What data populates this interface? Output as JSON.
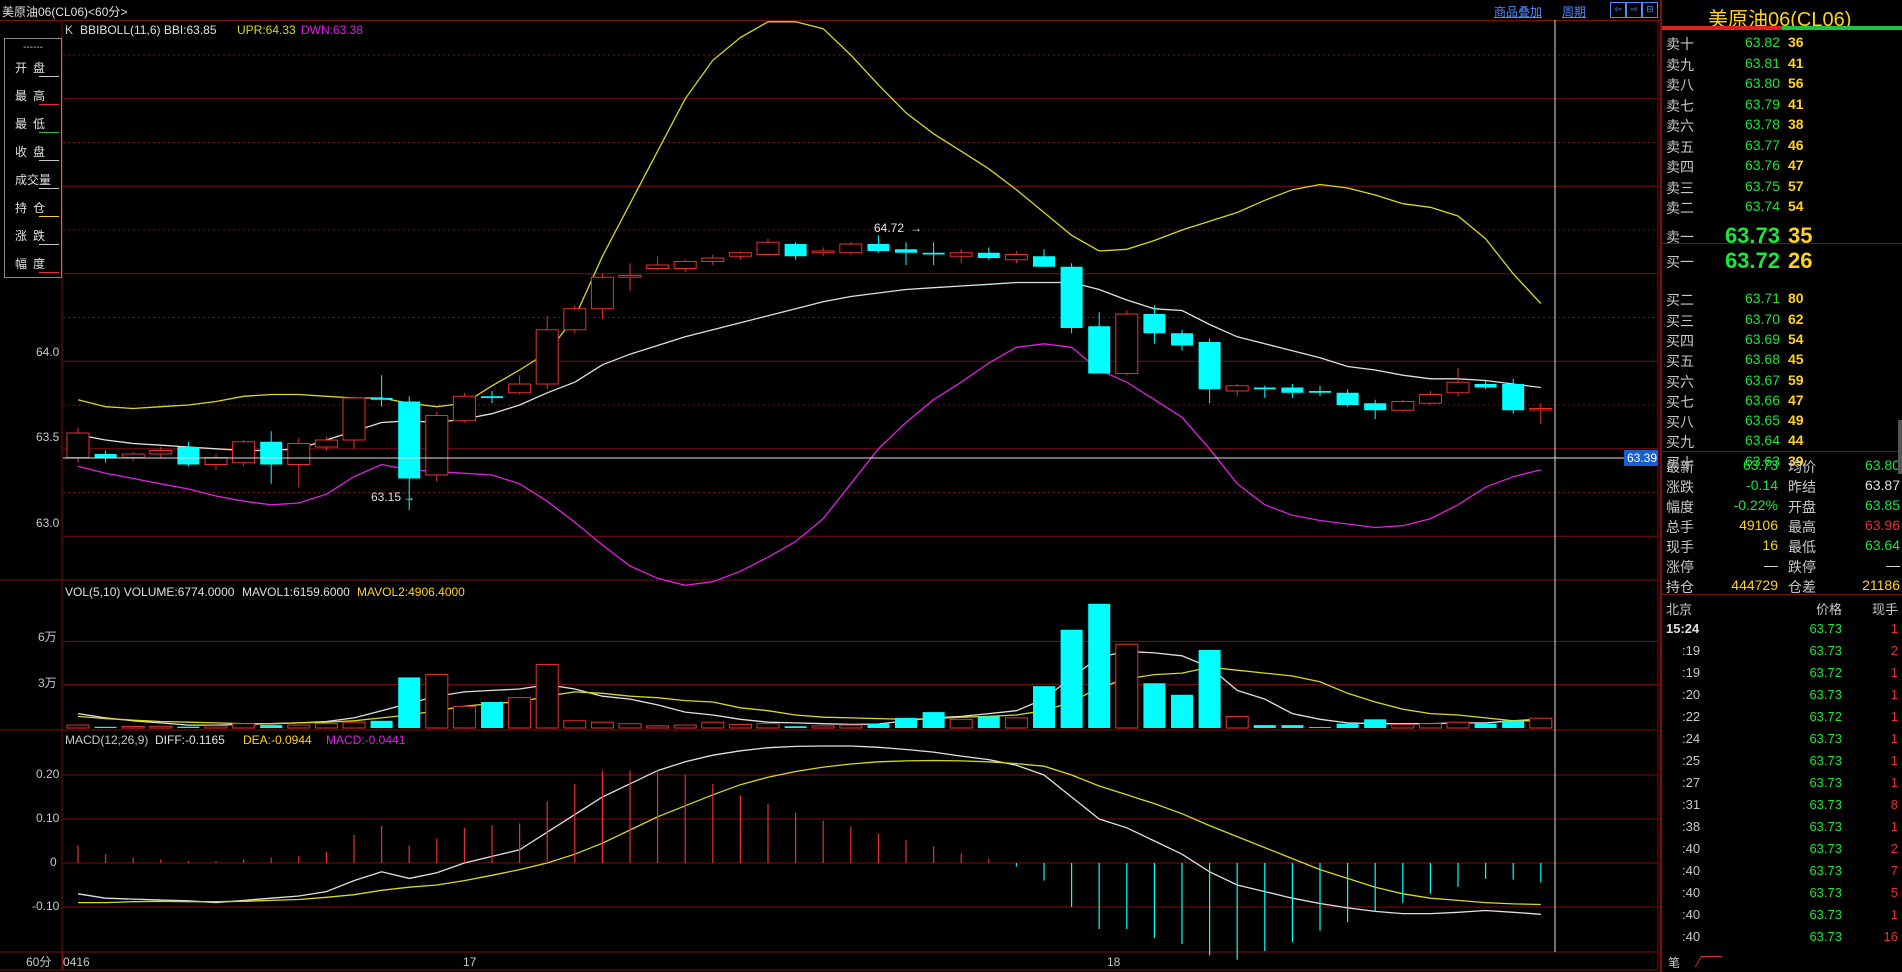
{
  "window": {
    "title": "美原油06(CL06)<60分>",
    "btn_overlay": "商品叠加",
    "btn_period": "周期",
    "btn_scroll_icons": [
      "⇦",
      "⇨",
      "⊟"
    ]
  },
  "legend": {
    "dash": "------",
    "items": [
      {
        "label": "开盘",
        "color": "#c8c8c8"
      },
      {
        "label": "最高",
        "color": "#e83030"
      },
      {
        "label": "最低",
        "color": "#20c040"
      },
      {
        "label": "收盘",
        "color": "#c8c8c8"
      },
      {
        "label": "成交量",
        "color": "#c8c8c8"
      },
      {
        "label": "持仓",
        "color": "#ffd21f"
      },
      {
        "label": "涨跌",
        "color": "#c8c8c8"
      },
      {
        "label": "幅度",
        "color": "#e83030"
      }
    ]
  },
  "main_panel": {
    "prefix": "K",
    "bbi_text": "BBIBOLL(11,6) BBI:63.85",
    "upr_text": "UPR:64.33",
    "dwn_text": "DWN:63.38",
    "y_ticks": [
      "64.0",
      "63.5",
      "63.0"
    ],
    "annot_high": "64.72",
    "annot_low": "63.15",
    "cursor_price": "63.39"
  },
  "vol_panel": {
    "text_vol": "VOL(5,10) VOLUME:6774.0000",
    "text_ma1": "MAVOL1:6159.6000",
    "text_ma2": "MAVOL2:4906.4000",
    "y_ticks": [
      "6万",
      "3万"
    ]
  },
  "macd_panel": {
    "text_head": "MACD(12,26,9)",
    "text_diff": "DIFF:-0.1165",
    "text_dea": "DEA:-0.0944",
    "text_macd": "MACD:-0.0441",
    "y_ticks": [
      "0.20",
      "0.10",
      "0",
      "-0.10"
    ]
  },
  "xaxis": {
    "period": "60分",
    "labels": [
      "0416",
      "17",
      "18"
    ]
  },
  "colors": {
    "up": "#e83030",
    "down": "#00ffff",
    "bbi": "#e0e0e0",
    "upr": "#d8d820",
    "dwn": "#e020e0",
    "grid": "#7a1010",
    "green": "#18e838",
    "yellow": "#ffd21f"
  },
  "chart_data": {
    "type": "candlestick",
    "y_range": [
      62.75,
      65.95
    ],
    "candles": [
      {
        "o": 63.45,
        "h": 63.62,
        "l": 63.42,
        "c": 63.59
      },
      {
        "o": 63.47,
        "h": 63.49,
        "l": 63.42,
        "c": 63.45
      },
      {
        "o": 63.45,
        "h": 63.48,
        "l": 63.43,
        "c": 63.47
      },
      {
        "o": 63.47,
        "h": 63.51,
        "l": 63.45,
        "c": 63.49
      },
      {
        "o": 63.51,
        "h": 63.54,
        "l": 63.4,
        "c": 63.41
      },
      {
        "o": 63.41,
        "h": 63.47,
        "l": 63.38,
        "c": 63.45
      },
      {
        "o": 63.42,
        "h": 63.55,
        "l": 63.4,
        "c": 63.54
      },
      {
        "o": 63.54,
        "h": 63.6,
        "l": 63.3,
        "c": 63.41
      },
      {
        "o": 63.41,
        "h": 63.56,
        "l": 63.28,
        "c": 63.53
      },
      {
        "o": 63.51,
        "h": 63.57,
        "l": 63.49,
        "c": 63.55
      },
      {
        "o": 63.55,
        "h": 63.8,
        "l": 63.5,
        "c": 63.79
      },
      {
        "o": 63.79,
        "h": 63.92,
        "l": 63.74,
        "c": 63.78
      },
      {
        "o": 63.77,
        "h": 63.8,
        "l": 63.15,
        "c": 63.33
      },
      {
        "o": 63.35,
        "h": 63.71,
        "l": 63.31,
        "c": 63.69
      },
      {
        "o": 63.66,
        "h": 63.82,
        "l": 63.65,
        "c": 63.8
      },
      {
        "o": 63.8,
        "h": 63.83,
        "l": 63.76,
        "c": 63.79
      },
      {
        "o": 63.82,
        "h": 63.92,
        "l": 63.81,
        "c": 63.87
      },
      {
        "o": 63.87,
        "h": 64.26,
        "l": 63.84,
        "c": 64.18
      },
      {
        "o": 64.18,
        "h": 64.32,
        "l": 64.16,
        "c": 64.3
      },
      {
        "o": 64.3,
        "h": 64.5,
        "l": 64.24,
        "c": 64.48
      },
      {
        "o": 64.48,
        "h": 64.56,
        "l": 64.4,
        "c": 64.49
      },
      {
        "o": 64.53,
        "h": 64.6,
        "l": 64.52,
        "c": 64.55
      },
      {
        "o": 64.53,
        "h": 64.58,
        "l": 64.51,
        "c": 64.57
      },
      {
        "o": 64.57,
        "h": 64.61,
        "l": 64.55,
        "c": 64.59
      },
      {
        "o": 64.6,
        "h": 64.63,
        "l": 64.58,
        "c": 64.62
      },
      {
        "o": 64.61,
        "h": 64.7,
        "l": 64.6,
        "c": 64.68
      },
      {
        "o": 64.67,
        "h": 64.68,
        "l": 64.58,
        "c": 64.6
      },
      {
        "o": 64.62,
        "h": 64.65,
        "l": 64.6,
        "c": 64.63
      },
      {
        "o": 64.62,
        "h": 64.68,
        "l": 64.61,
        "c": 64.67
      },
      {
        "o": 64.67,
        "h": 64.72,
        "l": 64.62,
        "c": 64.63
      },
      {
        "o": 64.64,
        "h": 64.68,
        "l": 64.55,
        "c": 64.62
      },
      {
        "o": 64.62,
        "h": 64.68,
        "l": 64.55,
        "c": 64.61
      },
      {
        "o": 64.6,
        "h": 64.64,
        "l": 64.56,
        "c": 64.62
      },
      {
        "o": 64.62,
        "h": 64.65,
        "l": 64.58,
        "c": 64.59
      },
      {
        "o": 64.58,
        "h": 64.63,
        "l": 64.56,
        "c": 64.61
      },
      {
        "o": 64.6,
        "h": 64.64,
        "l": 64.54,
        "c": 64.54
      },
      {
        "o": 64.54,
        "h": 64.56,
        "l": 64.16,
        "c": 64.19
      },
      {
        "o": 64.2,
        "h": 64.28,
        "l": 63.95,
        "c": 63.93
      },
      {
        "o": 63.93,
        "h": 64.29,
        "l": 63.92,
        "c": 64.27
      },
      {
        "o": 64.27,
        "h": 64.32,
        "l": 64.1,
        "c": 64.16
      },
      {
        "o": 64.16,
        "h": 64.18,
        "l": 64.06,
        "c": 64.09
      },
      {
        "o": 64.11,
        "h": 64.13,
        "l": 63.76,
        "c": 63.84
      },
      {
        "o": 63.83,
        "h": 63.87,
        "l": 63.8,
        "c": 63.86
      },
      {
        "o": 63.85,
        "h": 63.86,
        "l": 63.79,
        "c": 63.84
      },
      {
        "o": 63.85,
        "h": 63.87,
        "l": 63.79,
        "c": 63.82
      },
      {
        "o": 63.83,
        "h": 63.86,
        "l": 63.8,
        "c": 63.82
      },
      {
        "o": 63.82,
        "h": 63.84,
        "l": 63.74,
        "c": 63.75
      },
      {
        "o": 63.76,
        "h": 63.78,
        "l": 63.67,
        "c": 63.72
      },
      {
        "o": 63.72,
        "h": 63.78,
        "l": 63.71,
        "c": 63.77
      },
      {
        "o": 63.76,
        "h": 63.83,
        "l": 63.75,
        "c": 63.81
      },
      {
        "o": 63.82,
        "h": 63.96,
        "l": 63.8,
        "c": 63.88
      },
      {
        "o": 63.87,
        "h": 63.89,
        "l": 63.84,
        "c": 63.85
      },
      {
        "o": 63.87,
        "h": 63.9,
        "l": 63.7,
        "c": 63.72
      },
      {
        "o": 63.73,
        "h": 63.76,
        "l": 63.64,
        "c": 63.73
      }
    ],
    "bbi": [
      63.58,
      63.55,
      63.53,
      63.52,
      63.51,
      63.5,
      63.49,
      63.49,
      63.5,
      63.55,
      63.6,
      63.65,
      63.66,
      63.65,
      63.67,
      63.7,
      63.75,
      63.82,
      63.88,
      63.98,
      64.04,
      64.09,
      64.14,
      64.18,
      64.22,
      64.26,
      64.3,
      64.34,
      64.37,
      64.39,
      64.41,
      64.42,
      64.43,
      64.44,
      64.45,
      64.45,
      64.45,
      64.41,
      64.35,
      64.3,
      64.29,
      64.21,
      64.14,
      64.1,
      64.06,
      64.02,
      63.97,
      63.95,
      63.92,
      63.9,
      63.9,
      63.89,
      63.87,
      63.85
    ],
    "upr": [
      63.78,
      63.74,
      63.73,
      63.74,
      63.75,
      63.77,
      63.8,
      63.81,
      63.81,
      63.8,
      63.79,
      63.79,
      63.76,
      63.74,
      63.76,
      63.86,
      63.95,
      64.05,
      64.25,
      64.6,
      64.9,
      65.2,
      65.5,
      65.72,
      65.85,
      65.94,
      65.94,
      65.9,
      65.75,
      65.58,
      65.42,
      65.3,
      65.2,
      65.1,
      64.98,
      64.85,
      64.72,
      64.63,
      64.64,
      64.69,
      64.75,
      64.8,
      64.85,
      64.92,
      64.98,
      65.01,
      64.99,
      64.95,
      64.9,
      64.88,
      64.83,
      64.7,
      64.5,
      64.33
    ],
    "dwn": [
      63.4,
      63.36,
      63.33,
      63.3,
      63.27,
      63.23,
      63.2,
      63.18,
      63.19,
      63.24,
      63.34,
      63.41,
      63.38,
      63.37,
      63.36,
      63.35,
      63.3,
      63.2,
      63.08,
      62.95,
      62.83,
      62.76,
      62.72,
      62.74,
      62.8,
      62.88,
      62.97,
      63.1,
      63.3,
      63.5,
      63.65,
      63.78,
      63.88,
      63.99,
      64.08,
      64.1,
      64.08,
      63.95,
      63.88,
      63.78,
      63.68,
      63.5,
      63.3,
      63.18,
      63.12,
      63.09,
      63.07,
      63.05,
      63.06,
      63.1,
      63.18,
      63.28,
      63.34,
      63.38
    ],
    "volume": [
      2000,
      800,
      1000,
      1200,
      900,
      1500,
      3000,
      2000,
      2000,
      3000,
      4000,
      5000,
      35000,
      37000,
      15000,
      18000,
      21000,
      44000,
      5000,
      4000,
      3000,
      1500,
      2000,
      4000,
      2500,
      3000,
      1200,
      1500,
      2000,
      3000,
      7000,
      11000,
      6000,
      8000,
      7000,
      29000,
      68000,
      86000,
      58000,
      31000,
      23000,
      54000,
      8000,
      2000,
      2000,
      600,
      3000,
      6000,
      2500,
      3000,
      4000,
      3000,
      5000,
      6774
    ],
    "mavol1": [
      10000,
      7000,
      5000,
      3500,
      2000,
      2000,
      2500,
      3000,
      3500,
      4500,
      7000,
      12000,
      17000,
      22000,
      25000,
      26000,
      27000,
      30000,
      27000,
      22000,
      20000,
      16000,
      11000,
      9000,
      6000,
      4000,
      3500,
      3000,
      2500,
      2800,
      5000,
      7000,
      8000,
      10000,
      12000,
      20000,
      35000,
      49000,
      53000,
      52000,
      50000,
      42000,
      26000,
      20000,
      10000,
      6000,
      3500,
      3000,
      3000,
      3000,
      3500,
      3500,
      5000,
      6159
    ],
    "mavol2": [
      8000,
      6500,
      5500,
      4500,
      4000,
      3500,
      3000,
      3000,
      3500,
      4000,
      5000,
      7000,
      9000,
      12000,
      15000,
      17000,
      18000,
      22000,
      25000,
      24000,
      22000,
      21000,
      19000,
      18000,
      14000,
      12000,
      9000,
      7500,
      7000,
      6500,
      6000,
      6500,
      7500,
      8000,
      9000,
      12000,
      18000,
      28000,
      34000,
      37000,
      38000,
      42000,
      40000,
      38000,
      36000,
      32000,
      24000,
      18000,
      13000,
      10000,
      9000,
      7000,
      5000,
      4906
    ],
    "diff": [
      -0.07,
      -0.08,
      -0.082,
      -0.084,
      -0.086,
      -0.09,
      -0.085,
      -0.08,
      -0.075,
      -0.065,
      -0.04,
      -0.02,
      -0.035,
      -0.022,
      0.0,
      0.015,
      0.03,
      0.07,
      0.11,
      0.15,
      0.18,
      0.21,
      0.23,
      0.245,
      0.255,
      0.262,
      0.265,
      0.266,
      0.266,
      0.263,
      0.258,
      0.252,
      0.243,
      0.235,
      0.222,
      0.2,
      0.15,
      0.1,
      0.08,
      0.05,
      0.02,
      -0.02,
      -0.05,
      -0.065,
      -0.08,
      -0.092,
      -0.102,
      -0.11,
      -0.115,
      -0.115,
      -0.112,
      -0.108,
      -0.112,
      -0.1165
    ],
    "dea": [
      -0.09,
      -0.09,
      -0.088,
      -0.087,
      -0.088,
      -0.088,
      -0.087,
      -0.085,
      -0.083,
      -0.078,
      -0.072,
      -0.062,
      -0.055,
      -0.05,
      -0.04,
      -0.028,
      -0.015,
      0.0,
      0.02,
      0.045,
      0.075,
      0.105,
      0.13,
      0.155,
      0.178,
      0.195,
      0.208,
      0.218,
      0.225,
      0.23,
      0.232,
      0.233,
      0.232,
      0.23,
      0.226,
      0.22,
      0.2,
      0.175,
      0.155,
      0.135,
      0.112,
      0.085,
      0.06,
      0.035,
      0.01,
      -0.015,
      -0.035,
      -0.055,
      -0.07,
      -0.08,
      -0.085,
      -0.09,
      -0.093,
      -0.0944
    ],
    "macd": [
      0.04,
      0.02,
      0.012,
      0.008,
      0.005,
      0.004,
      0.008,
      0.012,
      0.016,
      0.026,
      0.064,
      0.084,
      0.04,
      0.056,
      0.08,
      0.086,
      0.09,
      0.14,
      0.18,
      0.21,
      0.21,
      0.21,
      0.2,
      0.18,
      0.154,
      0.134,
      0.114,
      0.096,
      0.082,
      0.066,
      0.052,
      0.038,
      0.022,
      0.01,
      -0.008,
      -0.04,
      -0.1,
      -0.15,
      -0.15,
      -0.17,
      -0.184,
      -0.21,
      -0.22,
      -0.2,
      -0.18,
      -0.154,
      -0.134,
      -0.11,
      -0.09,
      -0.07,
      -0.054,
      -0.036,
      -0.038,
      -0.0441
    ]
  },
  "order_book": {
    "name": "美原油06(CL06)",
    "asks": [
      {
        "label": "卖十",
        "price": "63.82",
        "vol": "36"
      },
      {
        "label": "卖九",
        "price": "63.81",
        "vol": "41"
      },
      {
        "label": "卖八",
        "price": "63.80",
        "vol": "56"
      },
      {
        "label": "卖七",
        "price": "63.79",
        "vol": "41"
      },
      {
        "label": "卖六",
        "price": "63.78",
        "vol": "38"
      },
      {
        "label": "卖五",
        "price": "63.77",
        "vol": "46"
      },
      {
        "label": "卖四",
        "price": "63.76",
        "vol": "47"
      },
      {
        "label": "卖三",
        "price": "63.75",
        "vol": "57"
      },
      {
        "label": "卖二",
        "price": "63.74",
        "vol": "54"
      },
      {
        "label": "卖一",
        "price": "63.73",
        "vol": "35"
      }
    ],
    "bids": [
      {
        "label": "买一",
        "price": "63.72",
        "vol": "26"
      },
      {
        "label": "买二",
        "price": "63.71",
        "vol": "80"
      },
      {
        "label": "买三",
        "price": "63.70",
        "vol": "62"
      },
      {
        "label": "买四",
        "price": "63.69",
        "vol": "54"
      },
      {
        "label": "买五",
        "price": "63.68",
        "vol": "45"
      },
      {
        "label": "买六",
        "price": "63.67",
        "vol": "59"
      },
      {
        "label": "买七",
        "price": "63.66",
        "vol": "47"
      },
      {
        "label": "买八",
        "price": "63.65",
        "vol": "49"
      },
      {
        "label": "买九",
        "price": "63.64",
        "vol": "44"
      },
      {
        "label": "买十",
        "price": "63.63",
        "vol": "39"
      }
    ]
  },
  "stats": [
    {
      "l": "最新",
      "v": "63.73",
      "c": "#18e838",
      "l2": "均价",
      "v2": "63.80",
      "c2": "#18e838"
    },
    {
      "l": "涨跌",
      "v": "-0.14",
      "c": "#18e838",
      "l2": "昨结",
      "v2": "63.87",
      "c2": "#e0e0e0"
    },
    {
      "l": "幅度",
      "v": "-0.22%",
      "c": "#18e838",
      "l2": "开盘",
      "v2": "63.85",
      "c2": "#18e838"
    },
    {
      "l": "总手",
      "v": "49106",
      "c": "#ffd21f",
      "l2": "最高",
      "v2": "63.96",
      "c2": "#e83030"
    },
    {
      "l": "现手",
      "v": "16",
      "c": "#ffd21f",
      "l2": "最低",
      "v2": "63.64",
      "c2": "#18e838"
    },
    {
      "l": "涨停",
      "v": "—",
      "c": "#e0e0e0",
      "l2": "跌停",
      "v2": "—",
      "c2": "#e0e0e0"
    },
    {
      "l": "持仓",
      "v": "444729",
      "c": "#ffd21f",
      "l2": "仓差",
      "v2": "21186",
      "c2": "#ffd21f"
    }
  ],
  "ticks": {
    "head": {
      "t": "北京",
      "p": "价格",
      "v": "现手"
    },
    "rows": [
      {
        "t": "15:24",
        "p": "63.73",
        "v": "1"
      },
      {
        "t": ":19",
        "p": "63.73",
        "v": "2"
      },
      {
        "t": ":19",
        "p": "63.72",
        "v": "1"
      },
      {
        "t": ":20",
        "p": "63.73",
        "v": "1"
      },
      {
        "t": ":22",
        "p": "63.72",
        "v": "1"
      },
      {
        "t": ":24",
        "p": "63.73",
        "v": "1"
      },
      {
        "t": ":25",
        "p": "63.73",
        "v": "1"
      },
      {
        "t": ":27",
        "p": "63.73",
        "v": "1"
      },
      {
        "t": ":31",
        "p": "63.73",
        "v": "8"
      },
      {
        "t": ":38",
        "p": "63.73",
        "v": "1"
      },
      {
        "t": ":40",
        "p": "63.73",
        "v": "2"
      },
      {
        "t": ":40",
        "p": "63.73",
        "v": "7"
      },
      {
        "t": ":40",
        "p": "63.73",
        "v": "5"
      },
      {
        "t": ":40",
        "p": "63.73",
        "v": "1"
      },
      {
        "t": ":40",
        "p": "63.73",
        "v": "16"
      }
    ],
    "footer_tab": "笔"
  }
}
